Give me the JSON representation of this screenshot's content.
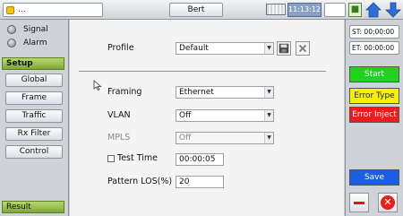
{
  "topbar": {
    "wifi_text": "...",
    "mode_tab": "Bert",
    "clock": "11:13:12",
    "icons": [
      "wifi-icon",
      "battery-icon",
      "status-icon",
      "home-icon",
      "down-arrow-icon"
    ]
  },
  "left": {
    "indicators": [
      {
        "label": "Signal"
      },
      {
        "label": "Alarm"
      }
    ],
    "setup_header": "Setup",
    "nav": [
      "Global",
      "Frame",
      "Traffic",
      "Rx Filter",
      "Control"
    ],
    "result_header": "Result"
  },
  "main": {
    "profile_label": "Profile",
    "profile_value": "Default",
    "framing_label": "Framing",
    "framing_value": "Ethernet",
    "vlan_label": "VLAN",
    "vlan_value": "Off",
    "mpls_label": "MPLS",
    "mpls_value": "Off",
    "test_time_label": "Test Time",
    "test_time_value": "00:00:05",
    "test_time_checked": false,
    "pattern_los_label": "Pattern LOS(%)",
    "pattern_los_value": "20"
  },
  "right": {
    "st_label": "ST: 00:00:00",
    "et_label": "ET: 00:00:00",
    "start": "Start",
    "error_type": "Error Type",
    "error_inject": "Error Inject",
    "save": "Save",
    "colors": {
      "start": "#1ed41e",
      "error_type": "#f5f200",
      "error_inject": "#f21a1a",
      "save": "#1a5fe0"
    }
  }
}
